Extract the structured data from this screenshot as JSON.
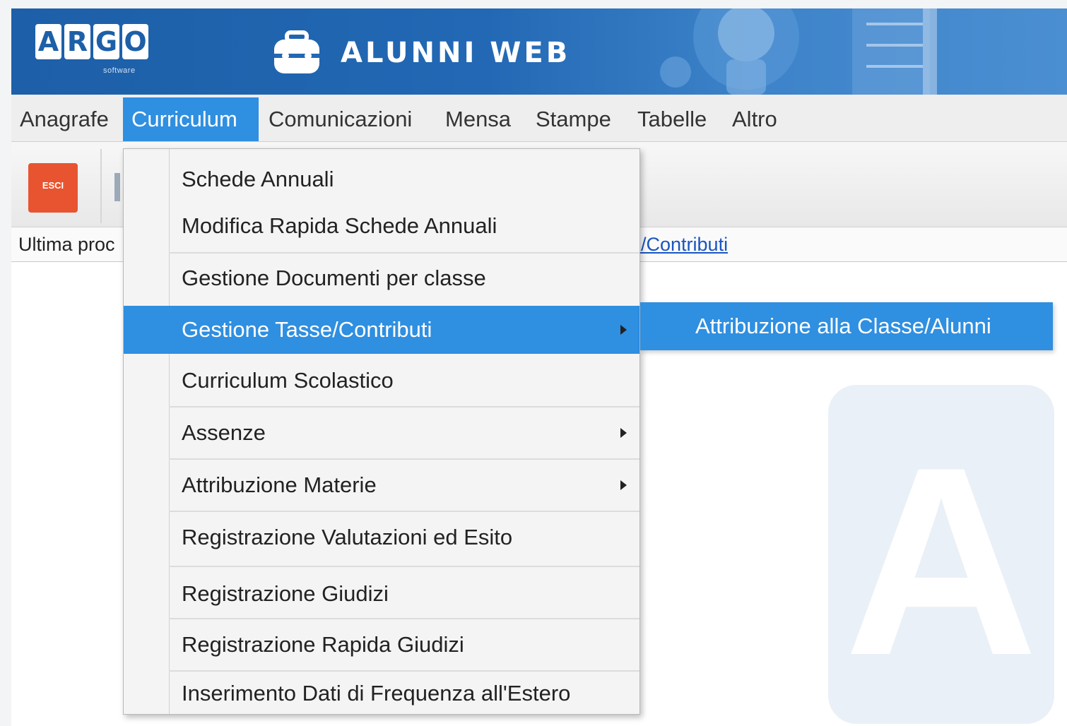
{
  "header": {
    "logo_letters": [
      "A",
      "R",
      "G",
      "O"
    ],
    "logo_sub": "software",
    "app_title": "ALUNNI WEB"
  },
  "menubar": {
    "items": [
      {
        "label": "Anagrafe"
      },
      {
        "label": "Curriculum"
      },
      {
        "label": "Comunicazioni"
      },
      {
        "label": "Mensa"
      },
      {
        "label": "Stampe"
      },
      {
        "label": "Tabelle"
      },
      {
        "label": "Altro"
      }
    ],
    "active": "Curriculum"
  },
  "toolbar": {
    "exit_label": "ESCI"
  },
  "status": {
    "prefix": "Ultima proc",
    "link_text": "e/Contributi"
  },
  "watermark_letter": "A",
  "dropdown": {
    "items": [
      {
        "label": "Schede Annuali"
      },
      {
        "label": "Modifica Rapida Schede Annuali"
      },
      {
        "label": "Gestione Documenti per classe"
      },
      {
        "label": "Gestione Tasse/Contributi"
      },
      {
        "label": "Curriculum Scolastico"
      },
      {
        "label": "Assenze"
      },
      {
        "label": "Attribuzione Materie"
      },
      {
        "label": "Registrazione Valutazioni ed Esito"
      },
      {
        "label": "Registrazione Giudizi"
      },
      {
        "label": "Registrazione Rapida Giudizi"
      },
      {
        "label": "Inserimento Dati di Frequenza all'Estero"
      }
    ],
    "highlighted": "Gestione Tasse/Contributi"
  },
  "submenu": {
    "items": [
      {
        "label": "Attribuzione alla Classe/Alunni"
      }
    ]
  },
  "colors": {
    "banner": "#1d5fa8",
    "accent": "#2f8fe0",
    "exit": "#e8542f",
    "link": "#1a55c0"
  }
}
